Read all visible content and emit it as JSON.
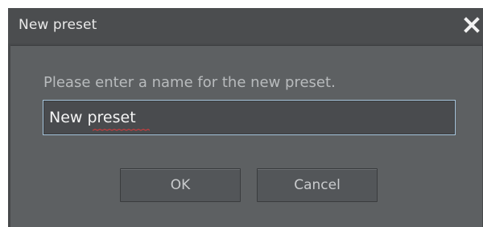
{
  "dialog": {
    "title": "New preset",
    "close_icon": "close-icon",
    "prompt": "Please enter a name for the new preset.",
    "name_input": {
      "value": "New preset",
      "placeholder": ""
    },
    "ok_label": "OK",
    "cancel_label": "Cancel"
  },
  "colors": {
    "titlebar": "#4b4d4f",
    "panel": "#5d6062",
    "input_border_focus": "#a7c5dc",
    "spellcheck_underline": "#d83c3c"
  }
}
